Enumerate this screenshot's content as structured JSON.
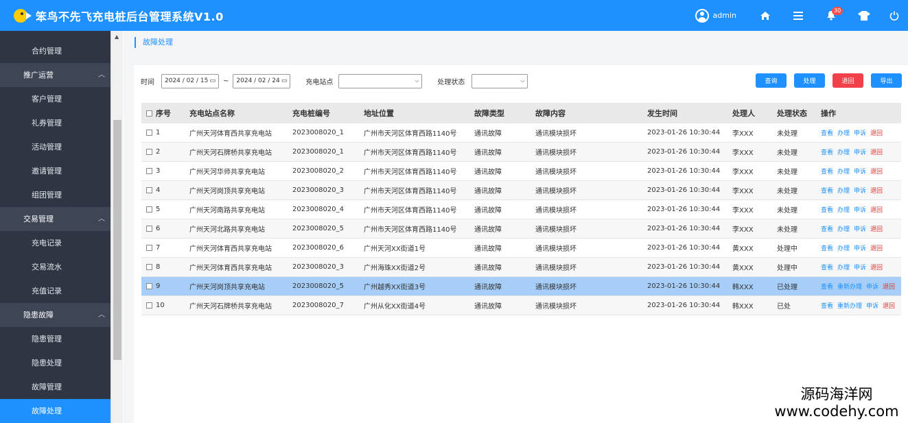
{
  "app": {
    "title": "笨鸟不先飞充电桩后台管理系统V1.0",
    "username": "admin",
    "notification_count": "30",
    "icons": [
      "user-icon",
      "home-icon",
      "menu-icon",
      "bell-icon",
      "tshirt-icon",
      "power-icon"
    ]
  },
  "sidebar": {
    "items": [
      {
        "type": "item",
        "label": "合约管理"
      },
      {
        "type": "group",
        "label": "推广运营"
      },
      {
        "type": "item",
        "label": "客户管理"
      },
      {
        "type": "item",
        "label": "礼券管理"
      },
      {
        "type": "item",
        "label": "活动管理"
      },
      {
        "type": "item",
        "label": "邀请管理"
      },
      {
        "type": "item",
        "label": "组团管理"
      },
      {
        "type": "group",
        "label": "交易管理"
      },
      {
        "type": "item",
        "label": "充电记录"
      },
      {
        "type": "item",
        "label": "交易流水"
      },
      {
        "type": "item",
        "label": "充值记录"
      },
      {
        "type": "group",
        "label": "隐患故障"
      },
      {
        "type": "item",
        "label": "隐患管理"
      },
      {
        "type": "item",
        "label": "隐患处理"
      },
      {
        "type": "item",
        "label": "故障管理"
      },
      {
        "type": "item",
        "label": "故障处理",
        "active": true
      }
    ]
  },
  "breadcrumb": "故障处理",
  "filters": {
    "time_label": "时间",
    "date_start": "2024 / 02 / 15",
    "date_sep": "~",
    "date_end": "2024 / 02 / 24",
    "station_label": "充电站点",
    "station_value": "",
    "status_label": "处理状态",
    "status_value": ""
  },
  "buttons": {
    "query": "查询",
    "process": "处理",
    "return": "退回",
    "export": "导出"
  },
  "colors": {
    "primary": "#1e90ff",
    "danger": "#f0404a",
    "sidebar_bg": "#3e4555",
    "selected_row": "#a7cef8"
  },
  "table": {
    "headers": [
      "序号",
      "充电站点名称",
      "充电桩编号",
      "地址位置",
      "故障类型",
      "故障内容",
      "发生时间",
      "处理人",
      "处理状态",
      "操作"
    ],
    "rows": [
      {
        "no": "1",
        "station": "广州天河体育西共享充电站",
        "pile": "2023008020_1",
        "address": "广州市天河区体育西路1140号",
        "type": "通讯故障",
        "content": "通讯模块损坏",
        "time": "2023-01-26 10:30:44",
        "handler": "李XXX",
        "status": "未处理",
        "actions": [
          "查看",
          "办理",
          "申诉",
          "退回"
        ]
      },
      {
        "no": "2",
        "station": "广州天河石牌桥共享充电站",
        "pile": "2023008020_1",
        "address": "广州市天河区体育西路1140号",
        "type": "通讯故障",
        "content": "通讯模块损坏",
        "time": "2023-01-26 10:30:44",
        "handler": "李XXX",
        "status": "未处理",
        "actions": [
          "查看",
          "办理",
          "申诉",
          "退回"
        ]
      },
      {
        "no": "3",
        "station": "广州天河华师共享充电站",
        "pile": "2023008020_2",
        "address": "广州市天河区体育西路1140号",
        "type": "通讯故障",
        "content": "通讯模块损坏",
        "time": "2023-01-26 10:30:44",
        "handler": "李XXX",
        "status": "未处理",
        "actions": [
          "查看",
          "办理",
          "申诉",
          "退回"
        ]
      },
      {
        "no": "4",
        "station": "广州天河岗顶共享充电站",
        "pile": "2023008020_3",
        "address": "广州市天河区体育西路1140号",
        "type": "通讯故障",
        "content": "通讯模块损坏",
        "time": "2023-01-26 10:30:44",
        "handler": "李XXX",
        "status": "未处理",
        "actions": [
          "查看",
          "办理",
          "申诉",
          "退回"
        ]
      },
      {
        "no": "5",
        "station": "广州天河南路共享充电站",
        "pile": "2023008020_4",
        "address": "广州市天河区体育西路1140号",
        "type": "通讯故障",
        "content": "通讯模块损坏",
        "time": "2023-01-26 10:30:44",
        "handler": "李XXX",
        "status": "未处理",
        "actions": [
          "查看",
          "办理",
          "申诉",
          "退回"
        ]
      },
      {
        "no": "6",
        "station": "广州天河北路共享充电站",
        "pile": "2023008020_5",
        "address": "广州市天河区体育西路1140号",
        "type": "通讯故障",
        "content": "通讯模块损坏",
        "time": "2023-01-26 10:30:44",
        "handler": "李XXX",
        "status": "未处理",
        "actions": [
          "查看",
          "办理",
          "申诉",
          "退回"
        ]
      },
      {
        "no": "7",
        "station": "广州天河体育西共享充电站",
        "pile": "2023008020_6",
        "address": "广州天河XX街道1号",
        "type": "通讯故障",
        "content": "通讯模块损坏",
        "time": "2023-01-26 10:30:44",
        "handler": "黄XXX",
        "status": "处理中",
        "actions": [
          "查看",
          "办理",
          "申诉",
          "退回"
        ]
      },
      {
        "no": "8",
        "station": "广州天河体育西共享充电站",
        "pile": "2023008020_3",
        "address": "广州海珠XX街道2号",
        "type": "通讯故障",
        "content": "通讯模块损坏",
        "time": "2023-01-26 10:30:44",
        "handler": "黄XXX",
        "status": "处理中",
        "actions": [
          "查看",
          "办理",
          "申诉",
          "退回"
        ]
      },
      {
        "no": "9",
        "station": "广州天河岗顶共享充电站",
        "pile": "2023008020_5",
        "address": "广州越秀XX街道3号",
        "type": "通讯故障",
        "content": "通讯模块损坏",
        "time": "2023-01-26 10:30:44",
        "handler": "韩XXX",
        "status": "已处理",
        "actions": [
          "查看",
          "重新办理",
          "申诉",
          "退回"
        ],
        "selected": true
      },
      {
        "no": "10",
        "station": "广州天河石牌桥共享充电站",
        "pile": "2023008020_7",
        "address": "广州从化XX街道4号",
        "type": "通讯故障",
        "content": "通讯模块损坏",
        "time": "2023-01-26 10:30:44",
        "handler": "韩XXX",
        "status": "已处",
        "actions": [
          "查看",
          "重新办理",
          "申诉",
          "退回"
        ]
      }
    ]
  },
  "watermark": {
    "line1": "源码海洋网",
    "line2": "www.codehy.com"
  }
}
